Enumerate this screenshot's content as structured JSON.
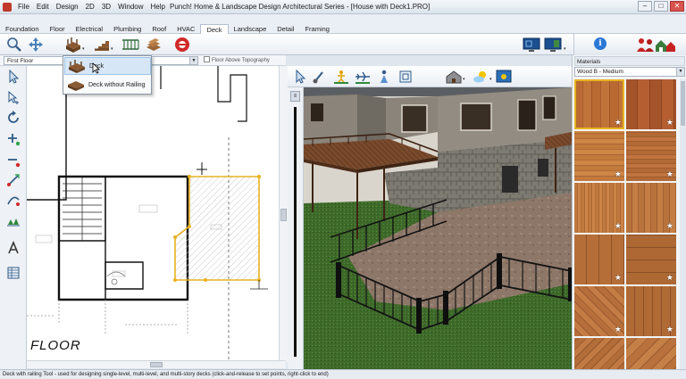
{
  "window": {
    "title": "Punch! Home & Landscape Design Architectural Series - [House with Deck1.PRO]",
    "minimize": "–",
    "maximize": "□",
    "close": "✕"
  },
  "menu": [
    "File",
    "Edit",
    "Design",
    "2D",
    "3D",
    "Window",
    "Help"
  ],
  "tabs": [
    {
      "label": "Foundation",
      "active": false
    },
    {
      "label": "Floor",
      "active": false
    },
    {
      "label": "Electrical",
      "active": false
    },
    {
      "label": "Plumbing",
      "active": false
    },
    {
      "label": "Roof",
      "active": false
    },
    {
      "label": "HVAC",
      "active": false
    },
    {
      "label": "Deck",
      "active": true
    },
    {
      "label": "Landscape",
      "active": false
    },
    {
      "label": "Detail",
      "active": false
    },
    {
      "label": "Framing",
      "active": false
    }
  ],
  "floor_selector": {
    "value": "First Floor",
    "topography_label": "Floor Above Topography"
  },
  "dropdown_menu": {
    "items": [
      {
        "label": "Deck",
        "highlighted": true
      },
      {
        "label": "Deck without Railing",
        "highlighted": false
      }
    ]
  },
  "plan": {
    "floor_label": "FLOOR"
  },
  "materials": {
    "header": "Materials",
    "selected": "Wood B - Medium",
    "selected_index": 0,
    "swatches": [
      {
        "pattern": "plank-warm"
      },
      {
        "pattern": "plank-red"
      },
      {
        "pattern": "plank-orange"
      },
      {
        "pattern": "plank-medium"
      },
      {
        "pattern": "strip-fine"
      },
      {
        "pattern": "strip-wide"
      },
      {
        "pattern": "parquet-a"
      },
      {
        "pattern": "parquet-b"
      },
      {
        "pattern": "herringbone-a"
      },
      {
        "pattern": "basket"
      },
      {
        "pattern": "herringbone-b"
      },
      {
        "pattern": "mixed"
      }
    ]
  },
  "status_bar": {
    "text": "Deck with railing Tool - used for designing single-level, multi-level, and multi-story decks (click-and-release to set points, right-click to end)"
  },
  "colors": {
    "selection_outline": "#e7b321",
    "info_blue": "#2b78d6",
    "close_red": "#d9544d"
  }
}
